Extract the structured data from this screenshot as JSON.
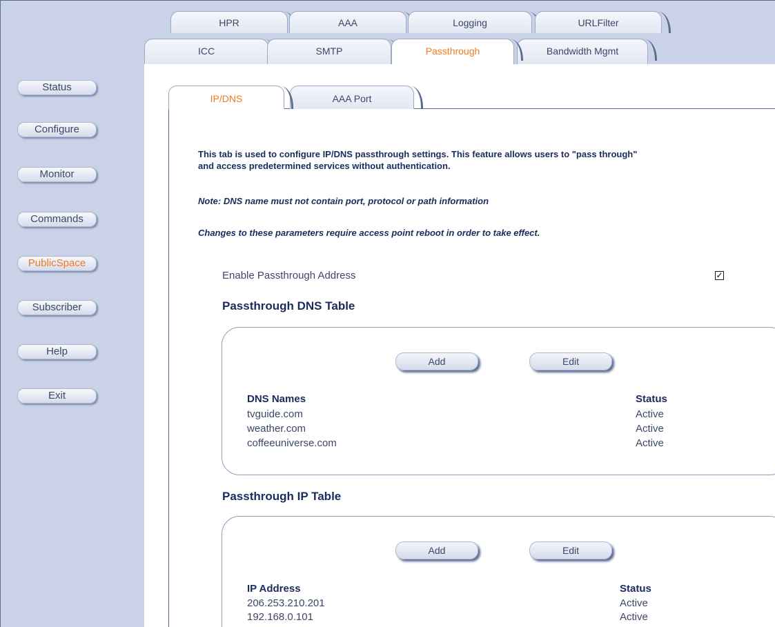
{
  "top_tabs_row1": [
    "HPR",
    "AAA",
    "Logging",
    "URLFilter"
  ],
  "top_tabs_row2": [
    "ICC",
    "SMTP",
    "Passthrough",
    "Bandwidth Mgmt"
  ],
  "sidebar": [
    "Status",
    "Configure",
    "Monitor",
    "Commands",
    "PublicSpace",
    "Subscriber",
    "Help",
    "Exit"
  ],
  "sub_tabs": [
    "IP/DNS",
    "AAA Port"
  ],
  "intro_line1": "This tab is used to configure IP/DNS passthrough settings. This feature allows users to \"pass through\"",
  "intro_line2": "and access predetermined services without authentication.",
  "note1": "Note: DNS name must not contain port, protocol or path information",
  "note2": "Changes to these parameters require access point reboot in order to take effect.",
  "enable_label": "Enable Passthrough Address",
  "enable_checked": "✓",
  "dns_section": {
    "title": "Passthrough DNS Table",
    "add": "Add",
    "edit": "Edit",
    "col1": "DNS Names",
    "col2": "Status",
    "rows": [
      {
        "name": "tvguide.com",
        "status": "Active"
      },
      {
        "name": "weather.com",
        "status": "Active"
      },
      {
        "name": "coffeeuniverse.com",
        "status": "Active"
      }
    ]
  },
  "ip_section": {
    "title": "Passthrough IP Table",
    "add": "Add",
    "edit": "Edit",
    "col1": "IP Address",
    "col2": "Status",
    "rows": [
      {
        "name": "206.253.210.201",
        "status": "Active"
      },
      {
        "name": "192.168.0.101",
        "status": "Active"
      }
    ]
  }
}
